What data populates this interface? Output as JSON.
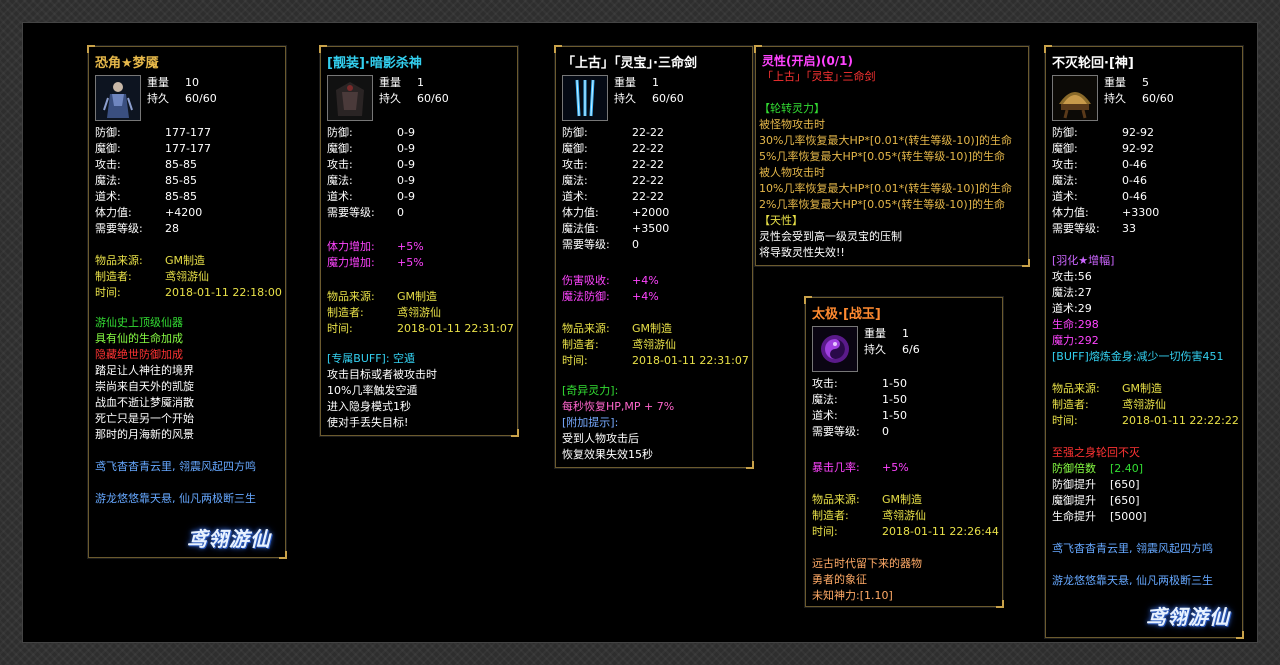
{
  "colors": {
    "frame": "#2e2e2e",
    "panel_border": "#6b5a2e",
    "corner": "#c9a24a",
    "background": "#000000"
  },
  "panels": {
    "p1": {
      "title": "恐角★梦魇",
      "weight_label": "重量",
      "weight": "10",
      "dur_label": "持久",
      "dur": "60/60",
      "stats": [
        {
          "label": "防御:",
          "value": "177-177"
        },
        {
          "label": "魔御:",
          "value": "177-177"
        },
        {
          "label": "攻击:",
          "value": "85-85"
        },
        {
          "label": "魔法:",
          "value": "85-85"
        },
        {
          "label": "道术:",
          "value": "85-85"
        },
        {
          "label": "体力值:",
          "value": "+4200"
        },
        {
          "label": "需要等级:",
          "value": "28"
        }
      ],
      "source": [
        {
          "label": "物品来源:",
          "value": "GM制造"
        },
        {
          "label": "制造者:",
          "value": "鸢翎游仙"
        },
        {
          "label": "时间:",
          "value": "2018-01-11 22:18:00"
        }
      ],
      "desc": [
        "游仙史上顶级仙器",
        "具有仙的生命加成",
        "隐藏绝世防御加成",
        "踏足让人神往的境界",
        "崇尚来自天外的凯旋",
        "战血不逝让梦魇消散",
        "死亡只是另一个开始",
        "那时的月海新的风景"
      ],
      "poem1": "鸢飞杳杳青云里, 翎震风起四方鸣",
      "poem2": "游龙悠悠靠天悬, 仙凡两极断三生",
      "logo": "鸢翎游仙"
    },
    "p2": {
      "title": "[靓装]·暗影杀神",
      "weight_label": "重量",
      "weight": "1",
      "dur_label": "持久",
      "dur": "60/60",
      "stats": [
        {
          "label": "防御:",
          "value": "0-9"
        },
        {
          "label": "魔御:",
          "value": "0-9"
        },
        {
          "label": "攻击:",
          "value": "0-9"
        },
        {
          "label": "魔法:",
          "value": "0-9"
        },
        {
          "label": "道术:",
          "value": "0-9"
        },
        {
          "label": "需要等级:",
          "value": "0"
        }
      ],
      "bonus": [
        {
          "label": "体力增加:",
          "value": "+5%"
        },
        {
          "label": "魔力增加:",
          "value": "+5%"
        }
      ],
      "source": [
        {
          "label": "物品来源:",
          "value": "GM制造"
        },
        {
          "label": "制造者:",
          "value": "鸢翎游仙"
        },
        {
          "label": "时间:",
          "value": "2018-01-11 22:31:07"
        }
      ],
      "buff_title": "[专属BUFF]: 空遁",
      "buff_lines": [
        "攻击目标或者被攻击时",
        "10%几率触发空遁",
        "进入隐身模式1秒",
        "使对手丢失目标!"
      ]
    },
    "p3": {
      "title": "「上古」「灵宝」·三命剑",
      "weight_label": "重量",
      "weight": "1",
      "dur_label": "持久",
      "dur": "60/60",
      "stats": [
        {
          "label": "防御:",
          "value": "22-22"
        },
        {
          "label": "魔御:",
          "value": "22-22"
        },
        {
          "label": "攻击:",
          "value": "22-22"
        },
        {
          "label": "魔法:",
          "value": "22-22"
        },
        {
          "label": "道术:",
          "value": "22-22"
        },
        {
          "label": "体力值:",
          "value": "+2000"
        },
        {
          "label": "魔法值:",
          "value": "+3500"
        },
        {
          "label": "需要等级:",
          "value": "0"
        }
      ],
      "bonus": [
        {
          "label": "伤害吸收:",
          "value": "+4%"
        },
        {
          "label": "魔法防御:",
          "value": "+4%"
        }
      ],
      "source": [
        {
          "label": "物品来源:",
          "value": "GM制造"
        },
        {
          "label": "制造者:",
          "value": "鸢翎游仙"
        },
        {
          "label": "时间:",
          "value": "2018-01-11 22:31:07"
        }
      ],
      "special_title": "[奇异灵力]:",
      "special_line": "每秒恢复HP,MP + 7%",
      "hint_title": "[附加提示]:",
      "hint_lines": [
        "受到人物攻击后",
        "恢复效果失效15秒"
      ]
    },
    "p4": {
      "title": "灵性(开启)(0/1)",
      "subtitle": "「上古」「灵宝」·三命剑",
      "sec1": "【轮转灵力】",
      "lines": [
        "被怪物攻击时",
        "30%几率恢复最大HP*[0.01*(转生等级-10)]的生命",
        "5%几率恢复最大HP*[0.05*(转生等级-10)]的生命",
        "被人物攻击时",
        "10%几率恢复最大HP*[0.01*(转生等级-10)]的生命",
        "2%几率恢复最大HP*[0.05*(转生等级-10)]的生命"
      ],
      "sec2": "【天性】",
      "tail": [
        "灵性会受到高一级灵宝的压制",
        "将导致灵性失效!!"
      ]
    },
    "p5": {
      "title": "太极·[战玉]",
      "weight_label": "重量",
      "weight": "1",
      "dur_label": "持久",
      "dur": "6/6",
      "stats": [
        {
          "label": "攻击:",
          "value": "1-50"
        },
        {
          "label": "魔法:",
          "value": "1-50"
        },
        {
          "label": "道术:",
          "value": "1-50"
        },
        {
          "label": "需要等级:",
          "value": "0"
        }
      ],
      "bonus": [
        {
          "label": "暴击几率:",
          "value": "+5%"
        }
      ],
      "source": [
        {
          "label": "物品来源:",
          "value": "GM制造"
        },
        {
          "label": "制造者:",
          "value": "鸢翎游仙"
        },
        {
          "label": "时间:",
          "value": "2018-01-11 22:26:44"
        }
      ],
      "desc": [
        "远古时代留下来的器物",
        "勇者的象征",
        "未知神力:[1.10]"
      ]
    },
    "p6": {
      "title": "不灭轮回·[神]",
      "weight_label": "重量",
      "weight": "5",
      "dur_label": "持久",
      "dur": "60/60",
      "stats": [
        {
          "label": "防御:",
          "value": "92-92"
        },
        {
          "label": "魔御:",
          "value": "92-92"
        },
        {
          "label": "攻击:",
          "value": "0-46"
        },
        {
          "label": "魔法:",
          "value": "0-46"
        },
        {
          "label": "道术:",
          "value": "0-46"
        },
        {
          "label": "体力值:",
          "value": "+3300"
        },
        {
          "label": "需要等级:",
          "value": "33"
        }
      ],
      "feather_title": "[羽化★增幅]",
      "feather": [
        "攻击:56",
        "魔法:27",
        "道术:29",
        "生命:298",
        "魔力:292"
      ],
      "buff": "[BUFF]熔炼金身:减少一切伤害451",
      "source": [
        {
          "label": "物品来源:",
          "value": "GM制造"
        },
        {
          "label": "制造者:",
          "value": "鸢翎游仙"
        },
        {
          "label": "时间:",
          "value": "2018-01-11 22:22:22"
        }
      ],
      "set_title": "至强之身轮回不灭",
      "set": [
        {
          "label": "防御倍数",
          "value": "[2.40]"
        },
        {
          "label": "防御提升",
          "value": "[650]"
        },
        {
          "label": "魔御提升",
          "value": "[650]"
        },
        {
          "label": "生命提升",
          "value": "[5000]"
        }
      ],
      "poem1": "鸢飞杳杳青云里, 翎震风起四方鸣",
      "poem2": "游龙悠悠靠天悬, 仙凡两极断三生",
      "logo": "鸢翎游仙"
    }
  }
}
